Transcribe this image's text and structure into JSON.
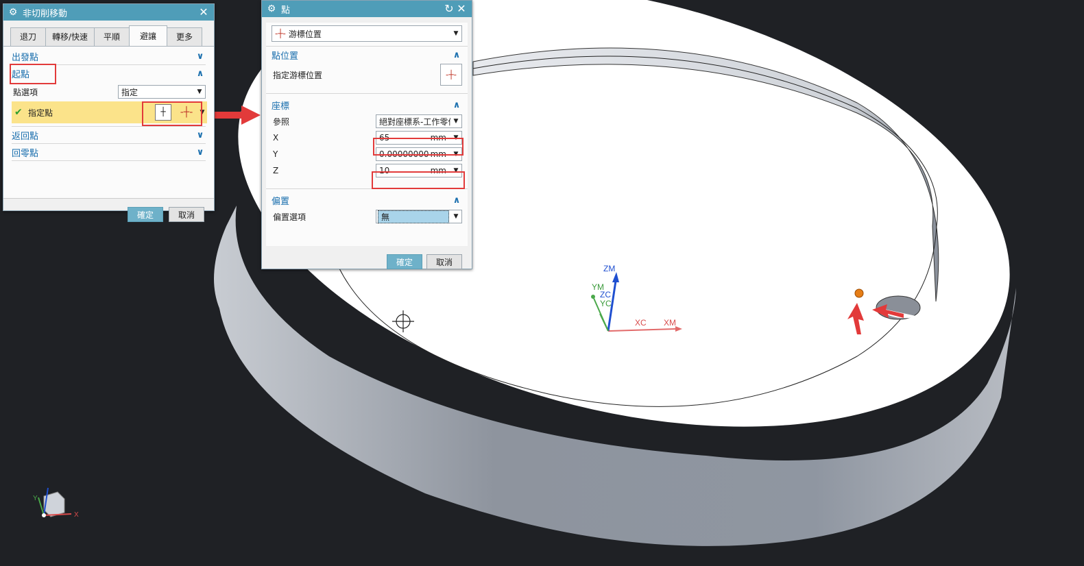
{
  "dialog_noncut": {
    "title": "非切削移動",
    "tabs": [
      "退刀",
      "轉移/快速",
      "平順",
      "避讓",
      "更多"
    ],
    "groups": {
      "start": "出發點",
      "startpoint": "起點",
      "ret": "返回點",
      "home": "回零點"
    },
    "point_option_label": "點選項",
    "point_option_value": "指定",
    "specify_point_label": "指定點",
    "ok": "確定",
    "cancel": "取消"
  },
  "dialog_point": {
    "title": "點",
    "type_value": "游標位置",
    "section_location": "點位置",
    "specify_cursor_label": "指定游標位置",
    "section_coords": "座標",
    "reference_label": "參照",
    "reference_value": "絕對座標系-工作零件",
    "x_label": "X",
    "x_value": "65",
    "y_label": "Y",
    "y_value": "0.00000000",
    "z_label": "Z",
    "z_value": "10",
    "unit": "mm",
    "section_offset": "偏置",
    "offset_option_label": "偏置選項",
    "offset_option_value": "無",
    "ok": "確定",
    "cancel": "取消"
  },
  "axes": {
    "zm": "ZM",
    "ym": "YM",
    "zc": "ZC",
    "yc": "YC",
    "xc": "XC",
    "xm": "XM",
    "mini_x": "X",
    "mini_y": "Y"
  },
  "colors": {
    "titlebar": "#4f9db8",
    "accent_text": "#1a6fae",
    "highlight_row": "#fbe38a",
    "annotation": "#e23a3a",
    "ring_top": "#ffffff",
    "ring_side": "#9aa0a9"
  }
}
